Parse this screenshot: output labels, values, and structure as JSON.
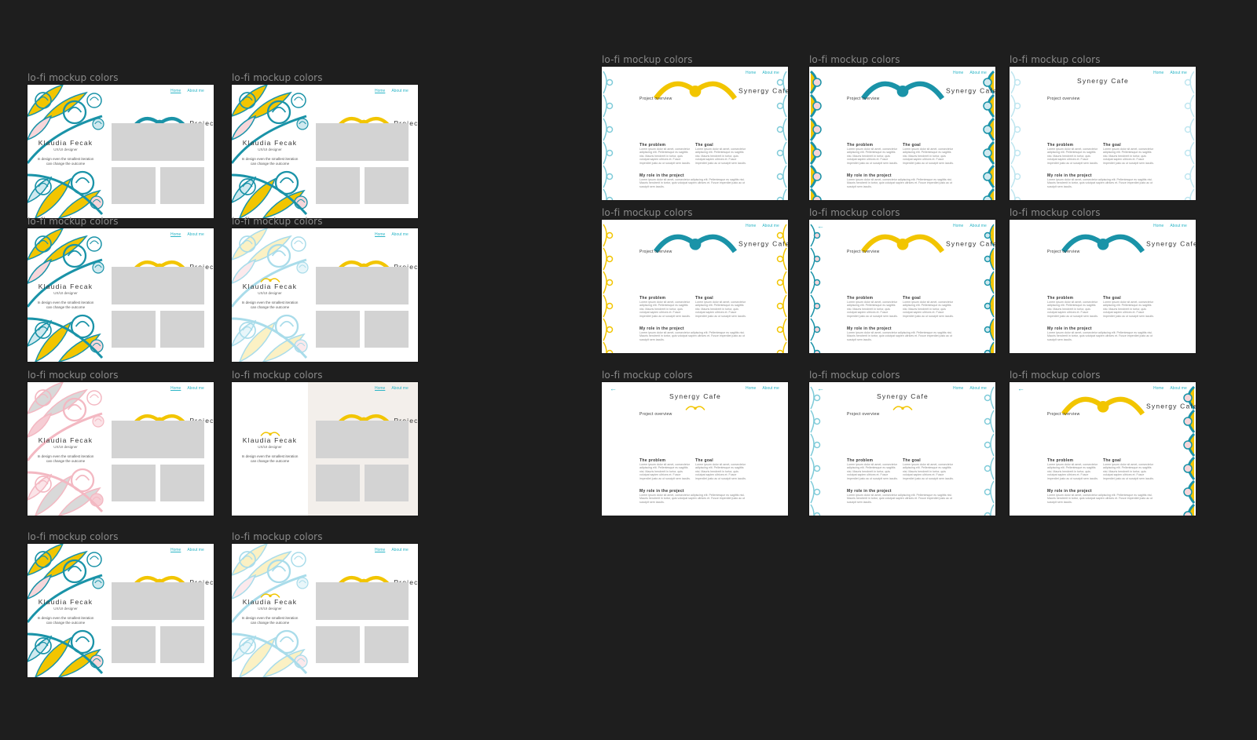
{
  "colors": {
    "teal": "#1a93a8",
    "yellow": "#f2c500",
    "cyan": "#2eb6c7",
    "lightblue": "#bfe6f0",
    "pink": "#f4c1c9",
    "gray": "#d3d3d3",
    "beige": "#f3efeb"
  },
  "canvas": {
    "frame_label": "lo-fi mockup colors"
  },
  "portfolio": {
    "nav_home": "Home",
    "nav_about": "About me",
    "title": "Projects",
    "name": "Klaudia Fecak",
    "role": "UX/UI designer",
    "tagline_1": "In design even the smallest iteration",
    "tagline_2": "can change the outcome"
  },
  "case": {
    "nav_home": "Home",
    "nav_about": "About me",
    "title": "Synergy Cafe",
    "overview": "Project overview",
    "problem": "The problem",
    "goal": "The goal",
    "role": "My role in the project",
    "lorem": "Lorem ipsum dolor sit amet, consectetur adipiscing elit. Pellentesque eu sagittis nisi. Mauris hendrerit in tortor, quis volutpat sapien ultrices et. Fusce imperdiet justo ac ut suscipit sem iaculis.",
    "back_arrow": "←"
  },
  "portfolio_frames": [
    {
      "variant": "teal-yellow",
      "title_ornament": "teal"
    },
    {
      "variant": "teal-yellow-top",
      "title_ornament": "yellow"
    },
    {
      "variant": "teal-yellow",
      "title_ornament": "yellow"
    },
    {
      "variant": "pale",
      "title_ornament": "yellow"
    },
    {
      "variant": "pink",
      "title_ornament": "yellow"
    },
    {
      "variant": "beige",
      "title_ornament": "yellow"
    },
    {
      "variant": "teal-yellow",
      "title_ornament": "yellow"
    },
    {
      "variant": "pale",
      "title_ornament": "yellow"
    }
  ],
  "case_frames": [
    {
      "variant": "light-teal",
      "ornament": "yellow"
    },
    {
      "variant": "bold",
      "ornament": "teal"
    },
    {
      "variant": "pale",
      "ornament": "none"
    },
    {
      "variant": "yellow-line",
      "ornament": "teal"
    },
    {
      "variant": "mixed",
      "ornament": "yellow"
    },
    {
      "variant": "plain",
      "ornament": "teal"
    },
    {
      "variant": "plain",
      "ornament": "yellow-below"
    },
    {
      "variant": "light-teal",
      "ornament": "yellow-below"
    },
    {
      "variant": "right-bold",
      "ornament": "yellow"
    }
  ]
}
